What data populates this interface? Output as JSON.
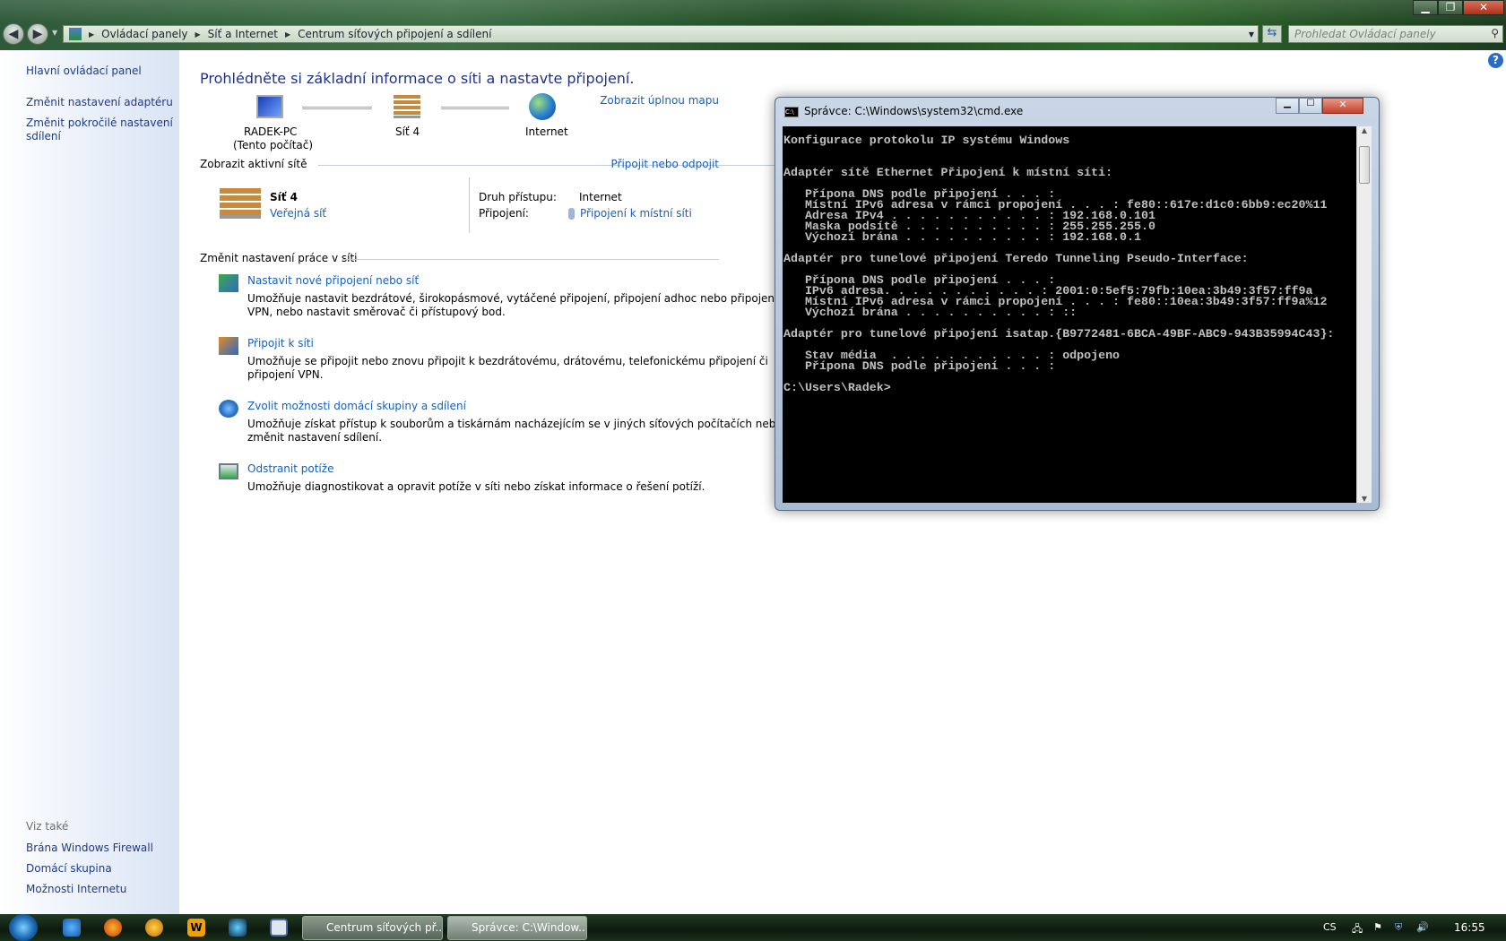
{
  "explorer": {
    "breadcrumb": [
      "Ovládací panely",
      "Síť a Internet",
      "Centrum síťových připojení a sdílení"
    ],
    "search_placeholder": "Prohledat Ovládací panely",
    "sidebar": {
      "items": [
        "Hlavní ovládací panel",
        "Změnit nastavení adaptéru",
        "Změnit pokročilé nastavení",
        "sdílení"
      ],
      "see_also_heading": "Viz také",
      "see_also": [
        "Brána Windows Firewall",
        "Domácí skupina",
        "Možnosti Internetu"
      ]
    },
    "heading": "Prohlédněte si základní informace o síti a nastavte připojení.",
    "map": {
      "computer_name": "RADEK-PC",
      "computer_sub": "(Tento počítač)",
      "network": "Síť 4",
      "internet": "Internet",
      "full_map_link": "Zobrazit úplnou mapu"
    },
    "active": {
      "heading": "Zobrazit aktivní sítě",
      "connect_link": "Připojit nebo odpojit",
      "network_name": "Síť 4",
      "network_type": "Veřejná síť",
      "access_label": "Druh přístupu:",
      "access_value": "Internet",
      "connection_label": "Připojení:",
      "connection_value": "Připojení k místní síti"
    },
    "change": {
      "heading": "Změnit nastavení práce v síti",
      "tasks": [
        {
          "title": "Nastavit nové připojení nebo síť",
          "desc1": "Umožňuje nastavit bezdrátové, širokopásmové, vytáčené připojení, připojení adhoc nebo připojení",
          "desc2": "VPN, nebo nastavit směrovač či přístupový bod."
        },
        {
          "title": "Připojit k síti",
          "desc1": "Umožňuje se připojit nebo znovu připojit k bezdrátovému, drátovému, telefonickému připojení či",
          "desc2": "připojení VPN."
        },
        {
          "title": "Zvolit možnosti domácí skupiny a sdílení",
          "desc1": "Umožňuje získat přístup k souborům a tiskárnám nacházejícím se v jiných síťových počítačích nebo",
          "desc2": "změnit nastavení sdílení."
        },
        {
          "title": "Odstranit potíže",
          "desc1": "Umožňuje diagnostikovat a opravit potíže v síti nebo získat informace o řešení potíží.",
          "desc2": ""
        }
      ]
    }
  },
  "cmd": {
    "title": "Správce: C:\\Windows\\system32\\cmd.exe",
    "lines": [
      "Konfigurace protokolu IP systému Windows",
      "",
      "",
      "Adaptér sítě Ethernet Připojení k místní síti:",
      "",
      "   Přípona DNS podle připojení . . . :",
      "   Místní IPv6 adresa v rámci propojení . . . : fe80::617e:d1c0:6bb9:ec20%11",
      "   Adresa IPv4 . . . . . . . . . . . : 192.168.0.101",
      "   Maska podsítě . . . . . . . . . . : 255.255.255.0",
      "   Výchozí brána . . . . . . . . . . : 192.168.0.1",
      "",
      "Adaptér pro tunelové připojení Teredo Tunneling Pseudo-Interface:",
      "",
      "   Přípona DNS podle připojení . . . :",
      "   IPv6 adresa. . . . . . . . . . . : 2001:0:5ef5:79fb:10ea:3b49:3f57:ff9a",
      "   Místní IPv6 adresa v rámci propojení . . . : fe80::10ea:3b49:3f57:ff9a%12",
      "   Výchozí brána . . . . . . . . . . : ::",
      "",
      "Adaptér pro tunelové připojení isatap.{B9772481-6BCA-49BF-ABC9-943B35994C43}:",
      "",
      "   Stav média  . . . . . . . . . . . : odpojeno",
      "   Přípona DNS podle připojení . . . :",
      "",
      "C:\\Users\\Radek>"
    ]
  },
  "taskbar": {
    "tasks": [
      "Centrum síťových př...",
      "Správce: C:\\Window..."
    ],
    "language": "CS",
    "clock": "16:55"
  }
}
